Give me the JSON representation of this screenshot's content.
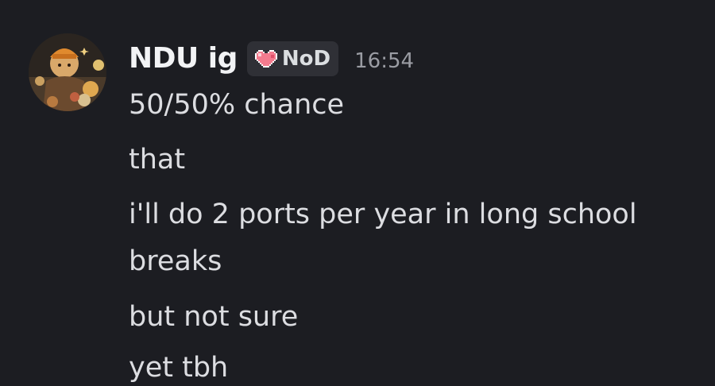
{
  "message": {
    "author": "NDU ig",
    "tag": {
      "label": "NoD",
      "icon": "pixel-heart-icon",
      "icon_color": "#f47b8e"
    },
    "timestamp": "16:54",
    "lines": [
      "50/50% chance",
      "that",
      "i'll do 2 ports per year in long school",
      "breaks",
      "but not sure",
      "yet tbh"
    ]
  },
  "colors": {
    "background": "#1c1d22",
    "username": "#f2f3f5",
    "text": "#dcdde1",
    "timestamp": "#9a9ca3",
    "tag_background": "#2f3036"
  }
}
